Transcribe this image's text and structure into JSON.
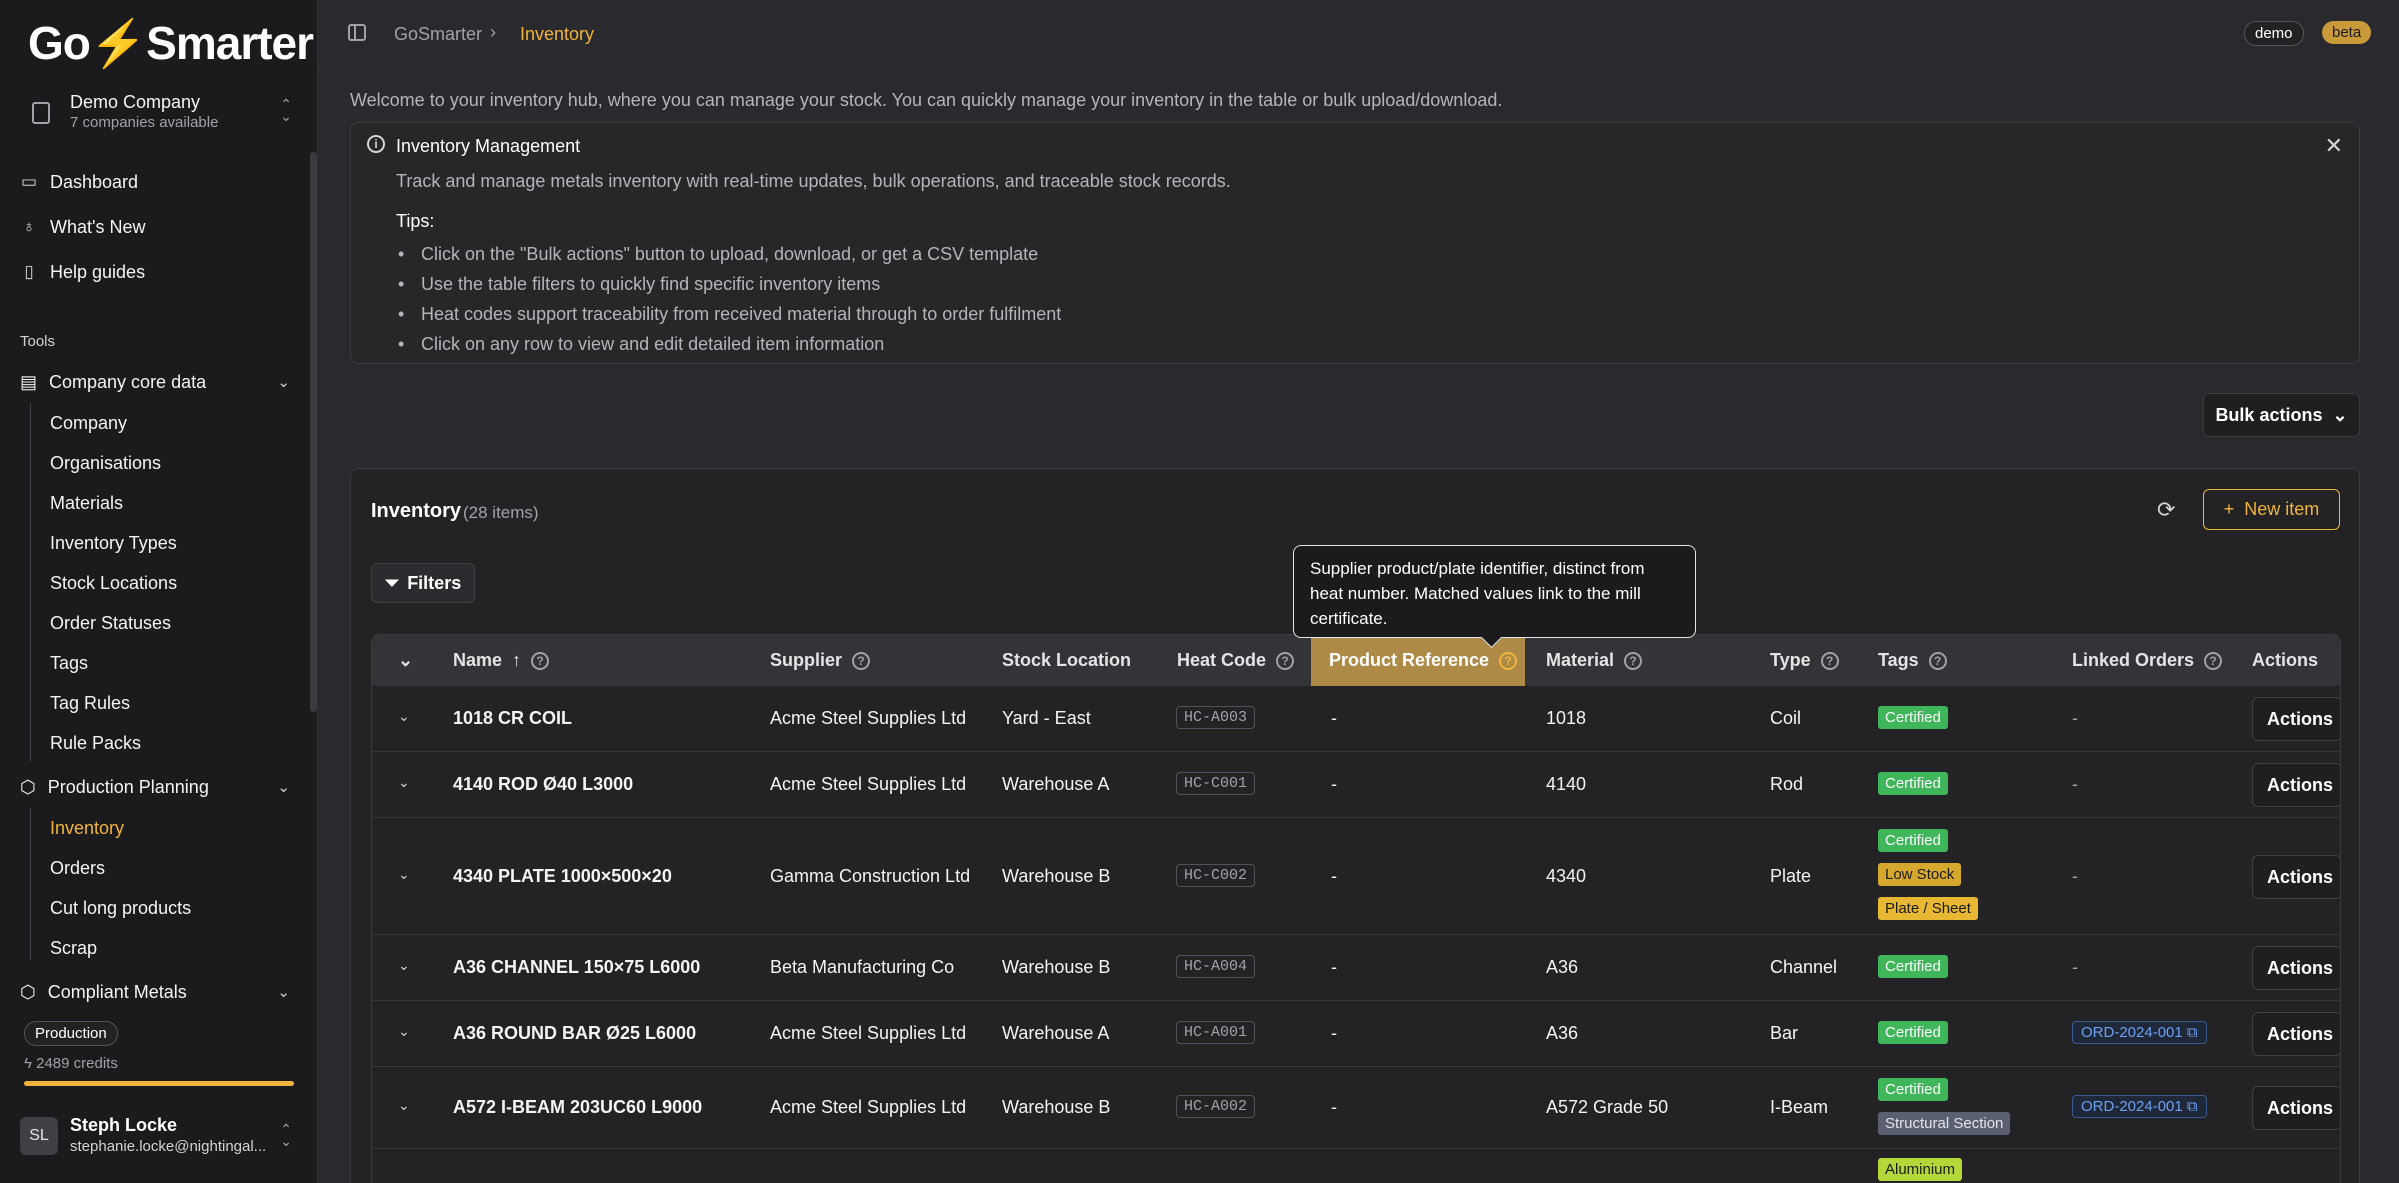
{
  "sidebar": {
    "logo_left": "Go",
    "logo_bolt": "⚡",
    "logo_right": "Smarter",
    "company": {
      "name": "Demo Company",
      "sub": "7 companies available"
    },
    "main_nav": [
      {
        "label": "Dashboard",
        "icon": "inbox-icon"
      },
      {
        "label": "What's New",
        "icon": "lightbulb-icon"
      },
      {
        "label": "Help guides",
        "icon": "book-icon"
      }
    ],
    "tools_label": "Tools",
    "core_group": {
      "label": "Company core data",
      "items": [
        "Company",
        "Organisations",
        "Materials",
        "Inventory Types",
        "Stock Locations",
        "Order Statuses",
        "Tags",
        "Tag Rules",
        "Rule Packs"
      ]
    },
    "planning_group": {
      "label": "Production Planning",
      "items": [
        "Inventory",
        "Orders",
        "Cut long products",
        "Scrap"
      ],
      "active": "Inventory"
    },
    "metals_group": {
      "label": "Compliant Metals"
    },
    "plan": "Production",
    "credits": "2489 credits",
    "user": {
      "initials": "SL",
      "name": "Steph Locke",
      "email": "stephanie.locke@nightingal..."
    }
  },
  "topbar": {
    "crumb_root": "GoSmarter",
    "crumb_current": "Inventory",
    "badge_demo": "demo",
    "badge_beta": "beta"
  },
  "welcome": "Welcome to your inventory hub, where you can manage your stock. You can quickly manage your inventory in the table or bulk upload/download.",
  "alert": {
    "title": "Inventory Management",
    "desc": "Track and manage metals inventory with real-time updates, bulk operations, and traceable stock records.",
    "tips_label": "Tips:",
    "tips": [
      "Click on the \"Bulk actions\" button to upload, download, or get a CSV template",
      "Use the table filters to quickly find specific inventory items",
      "Heat codes support traceability from received material through to order fulfilment",
      "Click on any row to view and edit detailed item information"
    ]
  },
  "bulk_label": "Bulk actions",
  "inventory": {
    "title": "Inventory",
    "count": "(28 items)",
    "new_label": "New item",
    "filters_label": "Filters",
    "tooltip": "Supplier product/plate identifier, distinct from heat number. Matched values link to the mill certificate.",
    "columns": [
      "Name",
      "Supplier",
      "Stock Location",
      "Heat Code",
      "Product Reference",
      "Material",
      "Type",
      "Tags",
      "Linked Orders",
      "Actions"
    ],
    "rows": [
      {
        "name": "1018 CR COIL",
        "supplier": "Acme Steel Supplies Ltd",
        "location": "Yard - East",
        "heat": "HC-A003",
        "ref": "-",
        "material": "1018",
        "type": "Coil",
        "tags": [
          "Certified"
        ],
        "order": "-",
        "action": "Actions"
      },
      {
        "name": "4140 ROD Ø40 L3000",
        "supplier": "Acme Steel Supplies Ltd",
        "location": "Warehouse A",
        "heat": "HC-C001",
        "ref": "-",
        "material": "4140",
        "type": "Rod",
        "tags": [
          "Certified"
        ],
        "order": "-",
        "action": "Actions"
      },
      {
        "name": "4340 PLATE 1000×500×20",
        "supplier": "Gamma Construction Ltd",
        "location": "Warehouse B",
        "heat": "HC-C002",
        "ref": "-",
        "material": "4340",
        "type": "Plate",
        "tags": [
          "Certified",
          "Low Stock",
          "Plate / Sheet"
        ],
        "order": "-",
        "action": "Actions"
      },
      {
        "name": "A36 CHANNEL 150×75 L6000",
        "supplier": "Beta Manufacturing Co",
        "location": "Warehouse B",
        "heat": "HC-A004",
        "ref": "-",
        "material": "A36",
        "type": "Channel",
        "tags": [
          "Certified"
        ],
        "order": "-",
        "action": "Actions"
      },
      {
        "name": "A36 ROUND BAR Ø25 L6000",
        "supplier": "Acme Steel Supplies Ltd",
        "location": "Warehouse A",
        "heat": "HC-A001",
        "ref": "-",
        "material": "A36",
        "type": "Bar",
        "tags": [
          "Certified"
        ],
        "order": "ORD-2024-001",
        "action": "Actions"
      },
      {
        "name": "A572 I-BEAM 203UC60 L9000",
        "supplier": "Acme Steel Supplies Ltd",
        "location": "Warehouse B",
        "heat": "HC-A002",
        "ref": "-",
        "material": "A572 Grade 50",
        "type": "I-Beam",
        "tags": [
          "Certified",
          "Structural Section"
        ],
        "order": "ORD-2024-001",
        "action": "Actions"
      },
      {
        "tags": [
          "Aluminium"
        ]
      }
    ]
  },
  "colors": {
    "accent": "#f0b43c",
    "certified": "#3fb65a",
    "link": "#6ea0f0"
  }
}
